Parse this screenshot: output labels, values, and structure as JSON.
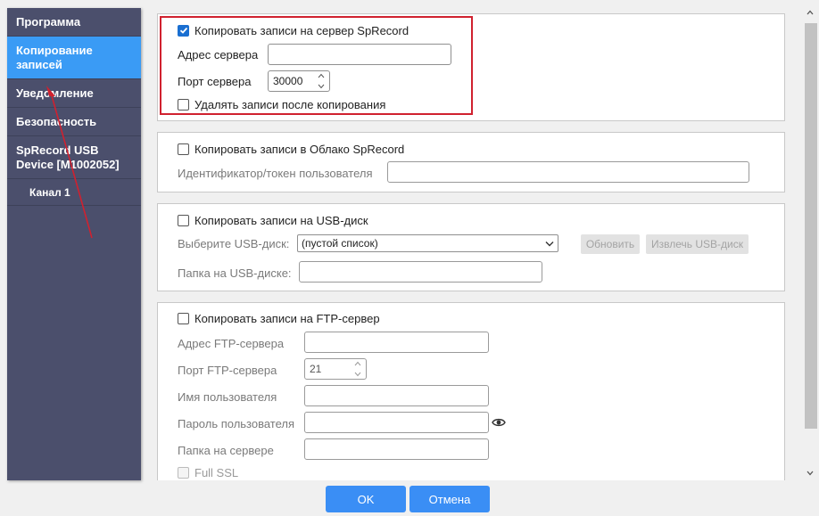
{
  "sidebar": {
    "items": [
      {
        "label": "Программа"
      },
      {
        "label": "Копирование записей"
      },
      {
        "label": "Уведомление"
      },
      {
        "label": "Безопасность"
      },
      {
        "label": "SpRecord USB Device [M1002052]"
      },
      {
        "label": "Канал 1"
      }
    ],
    "active_index": 1
  },
  "sprecord_server": {
    "enable_label": "Копировать записи на сервер SpRecord",
    "enabled": true,
    "address_label": "Адрес сервера",
    "address_value": "",
    "port_label": "Порт сервера",
    "port_value": "30000",
    "delete_label": "Удалять записи после копирования",
    "delete_checked": false
  },
  "cloud": {
    "enable_label": "Копировать записи в Облако SpRecord",
    "enabled": false,
    "token_label": "Идентификатор/токен пользователя",
    "token_value": ""
  },
  "usb": {
    "enable_label": "Копировать записи на USB-диск",
    "enabled": false,
    "select_label": "Выберите USB-диск:",
    "select_value": "(пустой список)",
    "refresh_label": "Обновить",
    "eject_label": "Извлечь USB-диск",
    "folder_label": "Папка на USB-диске:",
    "folder_value": ""
  },
  "ftp": {
    "enable_label": "Копировать записи на FTP-сервер",
    "enabled": false,
    "address_label": "Адрес FTP-сервера",
    "address_value": "",
    "port_label": "Порт FTP-сервера",
    "port_value": "21",
    "user_label": "Имя пользователя",
    "user_value": "",
    "password_label": "Пароль пользователя",
    "password_value": "",
    "folder_label": "Папка на сервере",
    "folder_value": "",
    "ssl_label": "Full SSL",
    "ssl_checked": false
  },
  "footer": {
    "ok_label": "OK",
    "cancel_label": "Отмена"
  },
  "colors": {
    "sidebar_bg": "#4b4f6c",
    "sidebar_active": "#3a9bf5",
    "accent": "#3a8ef5",
    "highlight": "#d0212f",
    "annotation_arrow": "#d0212f"
  }
}
